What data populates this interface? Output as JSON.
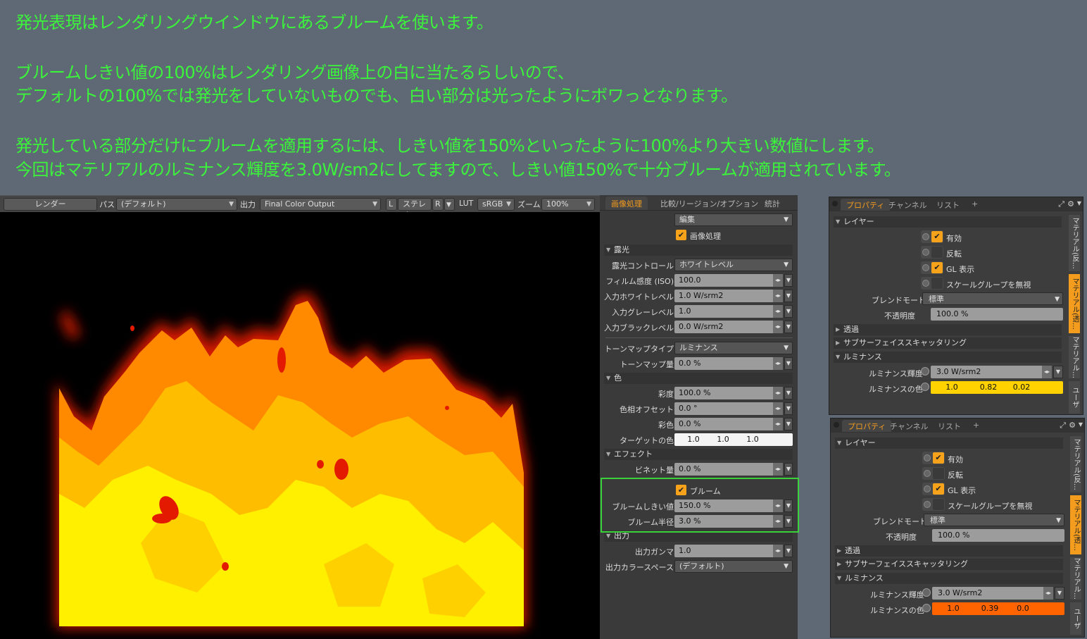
{
  "notes": [
    "発光表現はレンダリングウインドウにあるブルームを使います。",
    "ブルームしきい値の100%はレンダリング画像上の白に当たるらしいので、",
    "デフォルトの100%では発光をしていないものでも、白い部分は光ったようにボワっとなります。",
    "発光している部分だけにブルームを適用するには、しきい値を150%といったように100%より大きい数値にします。",
    "今回はマテリアルのルミナンス輝度を3.0W/sm2にしてますので、しきい値150%で十分ブルームが適用されています。"
  ],
  "render_toolbar": {
    "render_button": "レンダー",
    "pass_label": "パス",
    "pass_value": "(デフォルト)",
    "output_label": "出力",
    "output_value": "Final Color Output",
    "l_button": "L",
    "stereo_button": "ステレオ",
    "r_button": "R",
    "lut_label": "LUT",
    "lut_value": "sRGB",
    "zoom_label": "ズーム",
    "zoom_value": "100%"
  },
  "image_processing": {
    "tabs": [
      "画像処理",
      "比較/リージョン/オプション",
      "統計"
    ],
    "edit_dropdown": "編集",
    "enable_label": "画像処理",
    "exposure_section": "露光",
    "exposure_control_label": "露光コントロール",
    "exposure_control_value": "ホワイトレベル",
    "film_iso_label": "フィルム感度 (ISO)",
    "film_iso_value": "100.0",
    "input_white_label": "入力ホワイトレベル",
    "input_white_value": "1.0 W/srm2",
    "input_gray_label": "入力グレーレベル",
    "input_gray_value": "1.0",
    "input_black_label": "入力ブラックレベル",
    "input_black_value": "0.0 W/srm2",
    "tonemap_type_label": "トーンマップタイプ",
    "tonemap_type_value": "ルミナンス",
    "tonemap_amount_label": "トーンマップ量",
    "tonemap_amount_value": "0.0 %",
    "color_section": "色",
    "saturation_label": "彩度",
    "saturation_value": "100.0 %",
    "hue_offset_label": "色相オフセット",
    "hue_offset_value": "0.0 °",
    "color_label": "彩色",
    "color_value": "0.0 %",
    "target_color_label": "ターゲットの色",
    "target_color_values": [
      "1.0",
      "1.0",
      "1.0"
    ],
    "effect_section": "エフェクト",
    "vignette_label": "ビネット量",
    "vignette_value": "0.0 %",
    "bloom_label": "ブルーム",
    "bloom_threshold_label": "ブルームしきい値",
    "bloom_threshold_value": "150.0 %",
    "bloom_radius_label": "ブルーム半径",
    "bloom_radius_value": "3.0 %",
    "output_section": "出力",
    "output_gamma_label": "出力ガンマ",
    "output_gamma_value": "1.0",
    "output_colorspace_label": "出力カラースペース",
    "output_colorspace_value": "(デフォルト)"
  },
  "prop_panels": [
    {
      "tabs": [
        "プロパティ",
        "チャンネル",
        "リスト",
        "+"
      ],
      "layer_section": "レイヤー",
      "enabled_label": "有効",
      "invert_label": "反転",
      "gl_label": "GL 表示",
      "ignore_scale_label": "スケールグループを無視",
      "blend_label": "ブレンドモード",
      "blend_value": "標準",
      "opacity_label": "不透明度",
      "opacity_value": "100.0 %",
      "transparency_section": "透過",
      "sss_section": "サブサーフェイススキャッタリング",
      "luminance_section": "ルミナンス",
      "lum_intensity_label": "ルミナンス輝度",
      "lum_intensity_value": "3.0 W/srm2",
      "lum_color_label": "ルミナンスの色",
      "lum_color_values": [
        "1.0",
        "0.82",
        "0.02"
      ],
      "lum_color_hex": "#ffd200",
      "side_tabs": [
        "マテリアル(反…",
        "マテリアル(透…",
        "マテリアル…",
        "ユーザー…"
      ]
    },
    {
      "tabs": [
        "プロパティ",
        "チャンネル",
        "リスト",
        "+"
      ],
      "layer_section": "レイヤー",
      "enabled_label": "有効",
      "invert_label": "反転",
      "gl_label": "GL 表示",
      "ignore_scale_label": "スケールグループを無視",
      "blend_label": "ブレンドモード",
      "blend_value": "標準",
      "opacity_label": "不透明度",
      "opacity_value": "100.0 %",
      "transparency_section": "透過",
      "sss_section": "サブサーフェイススキャッタリング",
      "luminance_section": "ルミナンス",
      "lum_intensity_label": "ルミナンス輝度",
      "lum_intensity_value": "3.0 W/srm2",
      "lum_color_label": "ルミナンスの色",
      "lum_color_values": [
        "1.0",
        "0.39",
        "0.0"
      ],
      "lum_color_hex": "#ff6400",
      "side_tabs": [
        "マテリアル(反…",
        "マテリアル(透…",
        "マテリアル…",
        "ユーザー…"
      ]
    }
  ],
  "colors": {
    "accent": "#f39c1e",
    "note_text": "#3bf53b",
    "highlight": "#3bd13b"
  }
}
